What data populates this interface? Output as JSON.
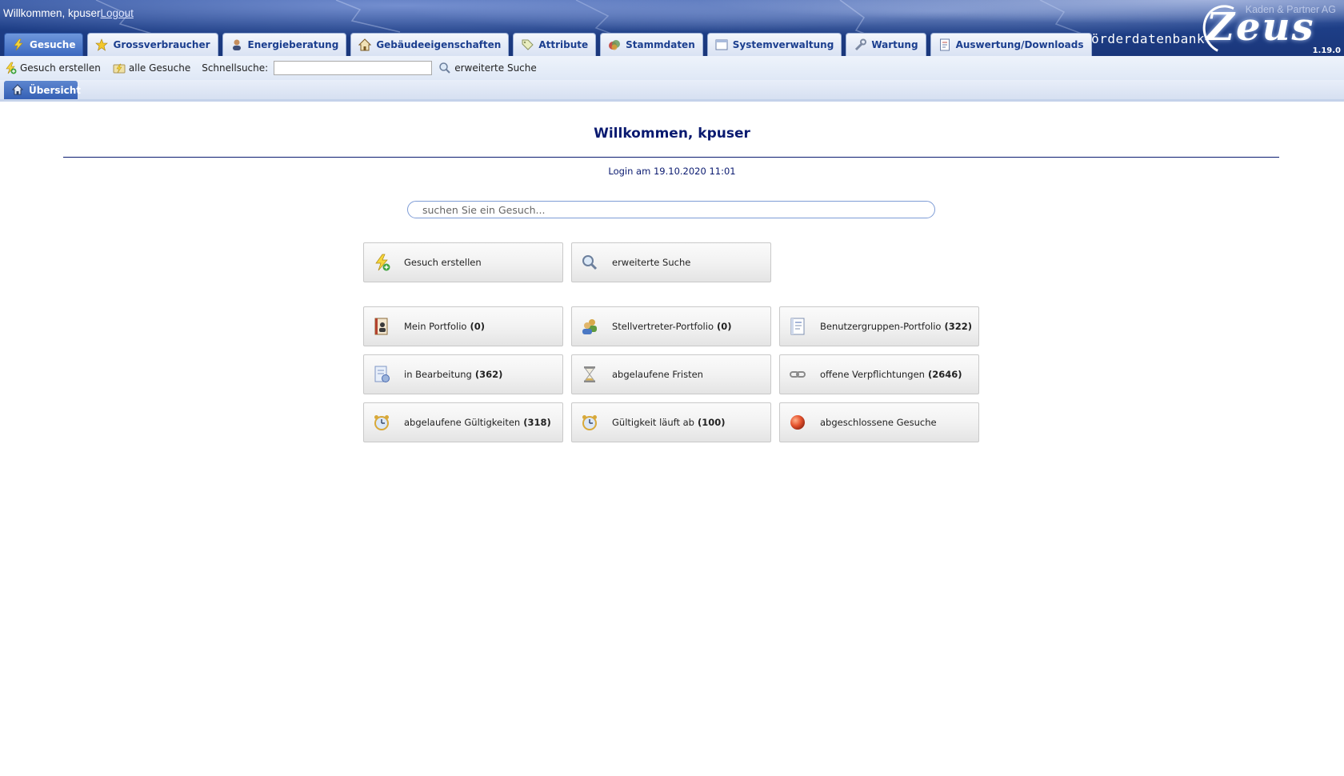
{
  "header": {
    "welcome_text": "Willkommen, kpuser",
    "logout_label": "Logout",
    "company": "Kaden & Partner AG",
    "app_name": "Förderdatenbank",
    "logo_text": "Zeus",
    "version": "1.19.0"
  },
  "tabs": [
    {
      "label": "Gesuche",
      "icon": "lightning-icon",
      "active": true
    },
    {
      "label": "Grossverbraucher",
      "icon": "star-icon"
    },
    {
      "label": "Energieberatung",
      "icon": "person-icon"
    },
    {
      "label": "Gebäudeeigenschaften",
      "icon": "house-icon"
    },
    {
      "label": "Attribute",
      "icon": "tag-icon"
    },
    {
      "label": "Stammdaten",
      "icon": "database-icon"
    },
    {
      "label": "Systemverwaltung",
      "icon": "window-icon"
    },
    {
      "label": "Wartung",
      "icon": "wrench-icon"
    },
    {
      "label": "Auswertung/Downloads",
      "icon": "report-icon"
    }
  ],
  "subnav": {
    "create_label": "Gesuch erstellen",
    "all_label": "alle Gesuche",
    "quicksearch_label": "Schnellsuche:",
    "quicksearch_value": "",
    "advanced_label": "erweiterte Suche"
  },
  "subtab": {
    "label": "Übersicht"
  },
  "main": {
    "title": "Willkommen, kpuser",
    "login_info": "Login am 19.10.2020 11:01",
    "search_placeholder": "suchen Sie ein Gesuch..."
  },
  "buttons": {
    "create": {
      "label": "Gesuch erstellen"
    },
    "advanced": {
      "label": "erweiterte Suche"
    },
    "my_portfolio": {
      "label": "Mein Portfolio",
      "count": "(0)"
    },
    "deputy_portfolio": {
      "label": "Stellvertreter-Portfolio",
      "count": "(0)"
    },
    "group_portfolio": {
      "label": "Benutzergruppen-Portfolio",
      "count": "(322)"
    },
    "in_progress": {
      "label": "in Bearbeitung",
      "count": "(362)"
    },
    "expired_deadlines": {
      "label": "abgelaufene Fristen"
    },
    "open_obligations": {
      "label": "offene Verpflichtungen",
      "count": "(2646)"
    },
    "expired_validities": {
      "label": "abgelaufene Gültigkeiten",
      "count": "(318)"
    },
    "validity_expiring": {
      "label": "Gültigkeit läuft ab",
      "count": "(100)"
    },
    "closed_requests": {
      "label": "abgeschlossene Gesuche"
    }
  }
}
